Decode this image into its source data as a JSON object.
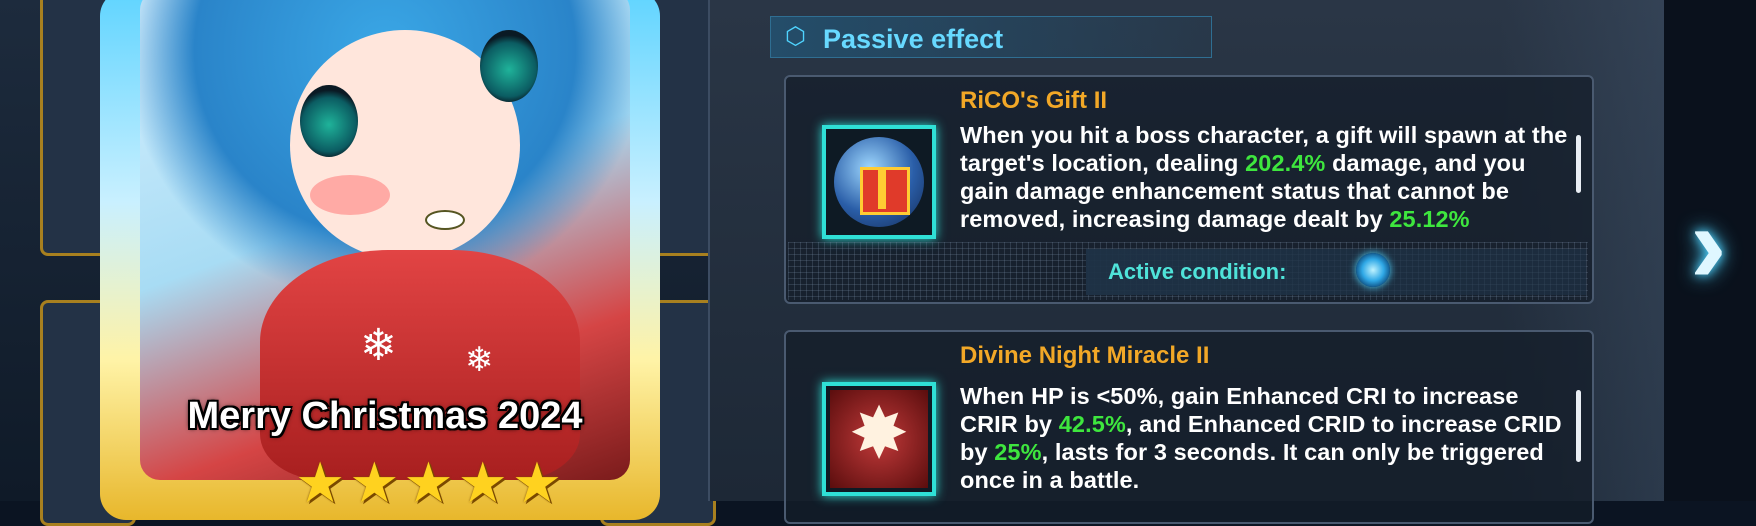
{
  "card": {
    "title": "Merry Christmas 2024",
    "stars": 5
  },
  "section": {
    "label": "Passive effect",
    "icon": "hexagon-icon"
  },
  "skills": [
    {
      "name": "RiCO's Gift II",
      "icon": "gift-orb-icon",
      "desc_parts": [
        "When you hit a boss character, a gift will spawn at the target's location, dealing ",
        "202.4%",
        " damage, and you gain damage enhancement status that cannot be removed, increasing damage dealt by ",
        "25.12%"
      ],
      "condition_label": "Active condition:",
      "condition_icon": "target-orb-icon"
    },
    {
      "name": "Divine Night Miracle II",
      "icon": "burst-icon",
      "desc_parts": [
        "When HP is <50%, gain Enhanced CRI to increase CRIR by ",
        "42.5%",
        ", and Enhanced CRID to increase CRID by ",
        "25%",
        ", lasts for 3 seconds. It can only be triggered once in a battle."
      ]
    }
  ],
  "colors": {
    "highlight": "#3ee63e",
    "skill_name": "#f2a827",
    "accent": "#4fd4ff"
  },
  "nav": {
    "next_icon": "chevron-right-icon"
  }
}
